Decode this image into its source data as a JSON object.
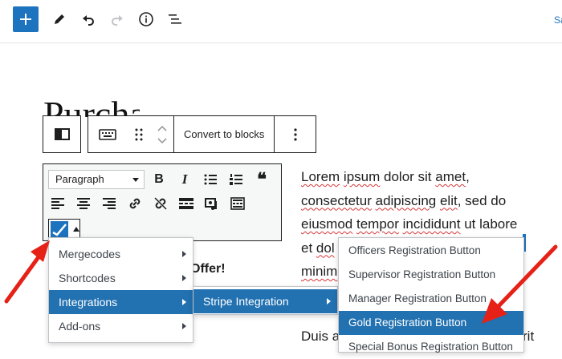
{
  "topbar": {
    "add_label": "Add block",
    "right_text": "Save draft"
  },
  "page": {
    "title": "Purchase"
  },
  "block_toolbar": {
    "convert_label": "Convert to blocks"
  },
  "classic_toolbar": {
    "format_value": "Paragraph"
  },
  "paragraph": {
    "lines": [
      {
        "w1": "Lorem",
        "s1": " ",
        "w2": "ipsum",
        "s2": " dolor sit ",
        "w3": "amet",
        "rest": ","
      },
      {
        "w1": "consectetur",
        "s1": " ",
        "w2": "adipiscing",
        "s2": " ",
        "w3": "elit",
        "rest": ", sed do"
      },
      {
        "w1": "eiusmod",
        "s1": " ",
        "w2": "tempor",
        "s2": " ",
        "w3": "incididunt",
        "rest": " ut labore"
      },
      {
        "w1": "et",
        "s1": " ",
        "w2": "dol",
        "s2": "",
        "w3": "",
        "rest": ""
      },
      {
        "w1": "minim",
        "s1": "",
        "w2": "",
        "s2": "",
        "w3": "",
        "rest": ""
      }
    ],
    "duis_text": "Duis a",
    "duis_end": "rit",
    "offer_text": "Offer!"
  },
  "menus": {
    "main": [
      {
        "label": "Mergecodes",
        "active": false
      },
      {
        "label": "Shortcodes",
        "active": false
      },
      {
        "label": "Integrations",
        "active": true
      },
      {
        "label": "Add-ons",
        "active": false
      }
    ],
    "integrations": [
      {
        "label": "Stripe Integration",
        "active": true
      }
    ],
    "stripe": [
      {
        "label": "Officers Registration Button",
        "active": false
      },
      {
        "label": "Supervisor Registration Button",
        "active": false
      },
      {
        "label": "Manager Registration Button",
        "active": false
      },
      {
        "label": "Gold Registration Button",
        "active": true
      },
      {
        "label": "Special Bonus Registration Button",
        "active": false
      }
    ]
  },
  "colors": {
    "accent": "#1e73be",
    "highlight": "#2271b1",
    "arrow": "#e62117"
  }
}
